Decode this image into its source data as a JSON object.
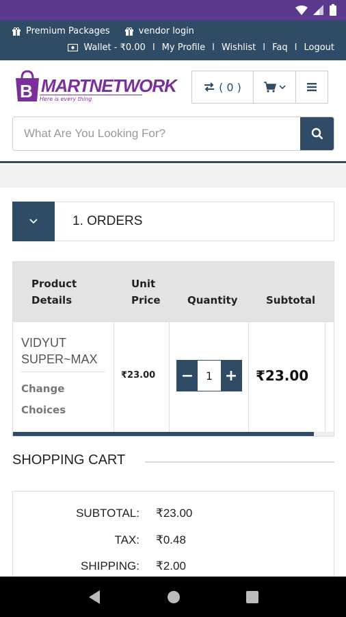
{
  "colors": {
    "status_bar": "#5b3a8e",
    "primary": "#2f4b66",
    "brand": "#7a2f9a",
    "table_header": "#e3e3e3"
  },
  "top_bar": {
    "premium_packages": "Premium Packages",
    "vendor_login": "vendor login",
    "wallet": "Wallet - ₹0.00",
    "my_profile": "My Profile",
    "wishlist": "Wishlist",
    "faq": "Faq",
    "logout": "Logout",
    "separator": "I"
  },
  "header": {
    "logo_text": "MARTNETWORK",
    "logo_tagline": "Here is every thing",
    "compare_count": "( 0 )"
  },
  "search": {
    "placeholder": "What Are You Looking For?"
  },
  "orders_section": {
    "title": "1. ORDERS"
  },
  "cart_table": {
    "headers": [
      "Product Details",
      "Unit Price",
      "Quantity",
      "Subtotal"
    ],
    "header_lines": {
      "product_1": "Product",
      "product_2": "Details",
      "unit_1": "Unit",
      "unit_2": "Price",
      "quantity": "Quantity",
      "subtotal": "Subtotal"
    },
    "row": {
      "product_line1": "VIDYUT",
      "product_line2": "SUPER~MAX",
      "change_1": "Change",
      "change_2": "Choices",
      "unit_price": "₹23.00",
      "quantity": "1",
      "subtotal": "₹23.00",
      "minus": "−",
      "plus": "+"
    }
  },
  "shopping_cart": {
    "title": "SHOPPING CART",
    "summary": [
      {
        "label": "SUBTOTAL:",
        "value": "₹23.00"
      },
      {
        "label": "TAX:",
        "value": "₹0.48"
      },
      {
        "label": "SHIPPING:",
        "value": "₹2.00"
      }
    ]
  },
  "icons": [
    "signal-icon",
    "wifi-icon",
    "battery-icon",
    "gift-icon",
    "wallet-icon",
    "compare-icon",
    "cart-icon",
    "menu-icon",
    "search-icon",
    "chevron-down-icon",
    "back-icon",
    "home-icon",
    "recents-icon"
  ]
}
